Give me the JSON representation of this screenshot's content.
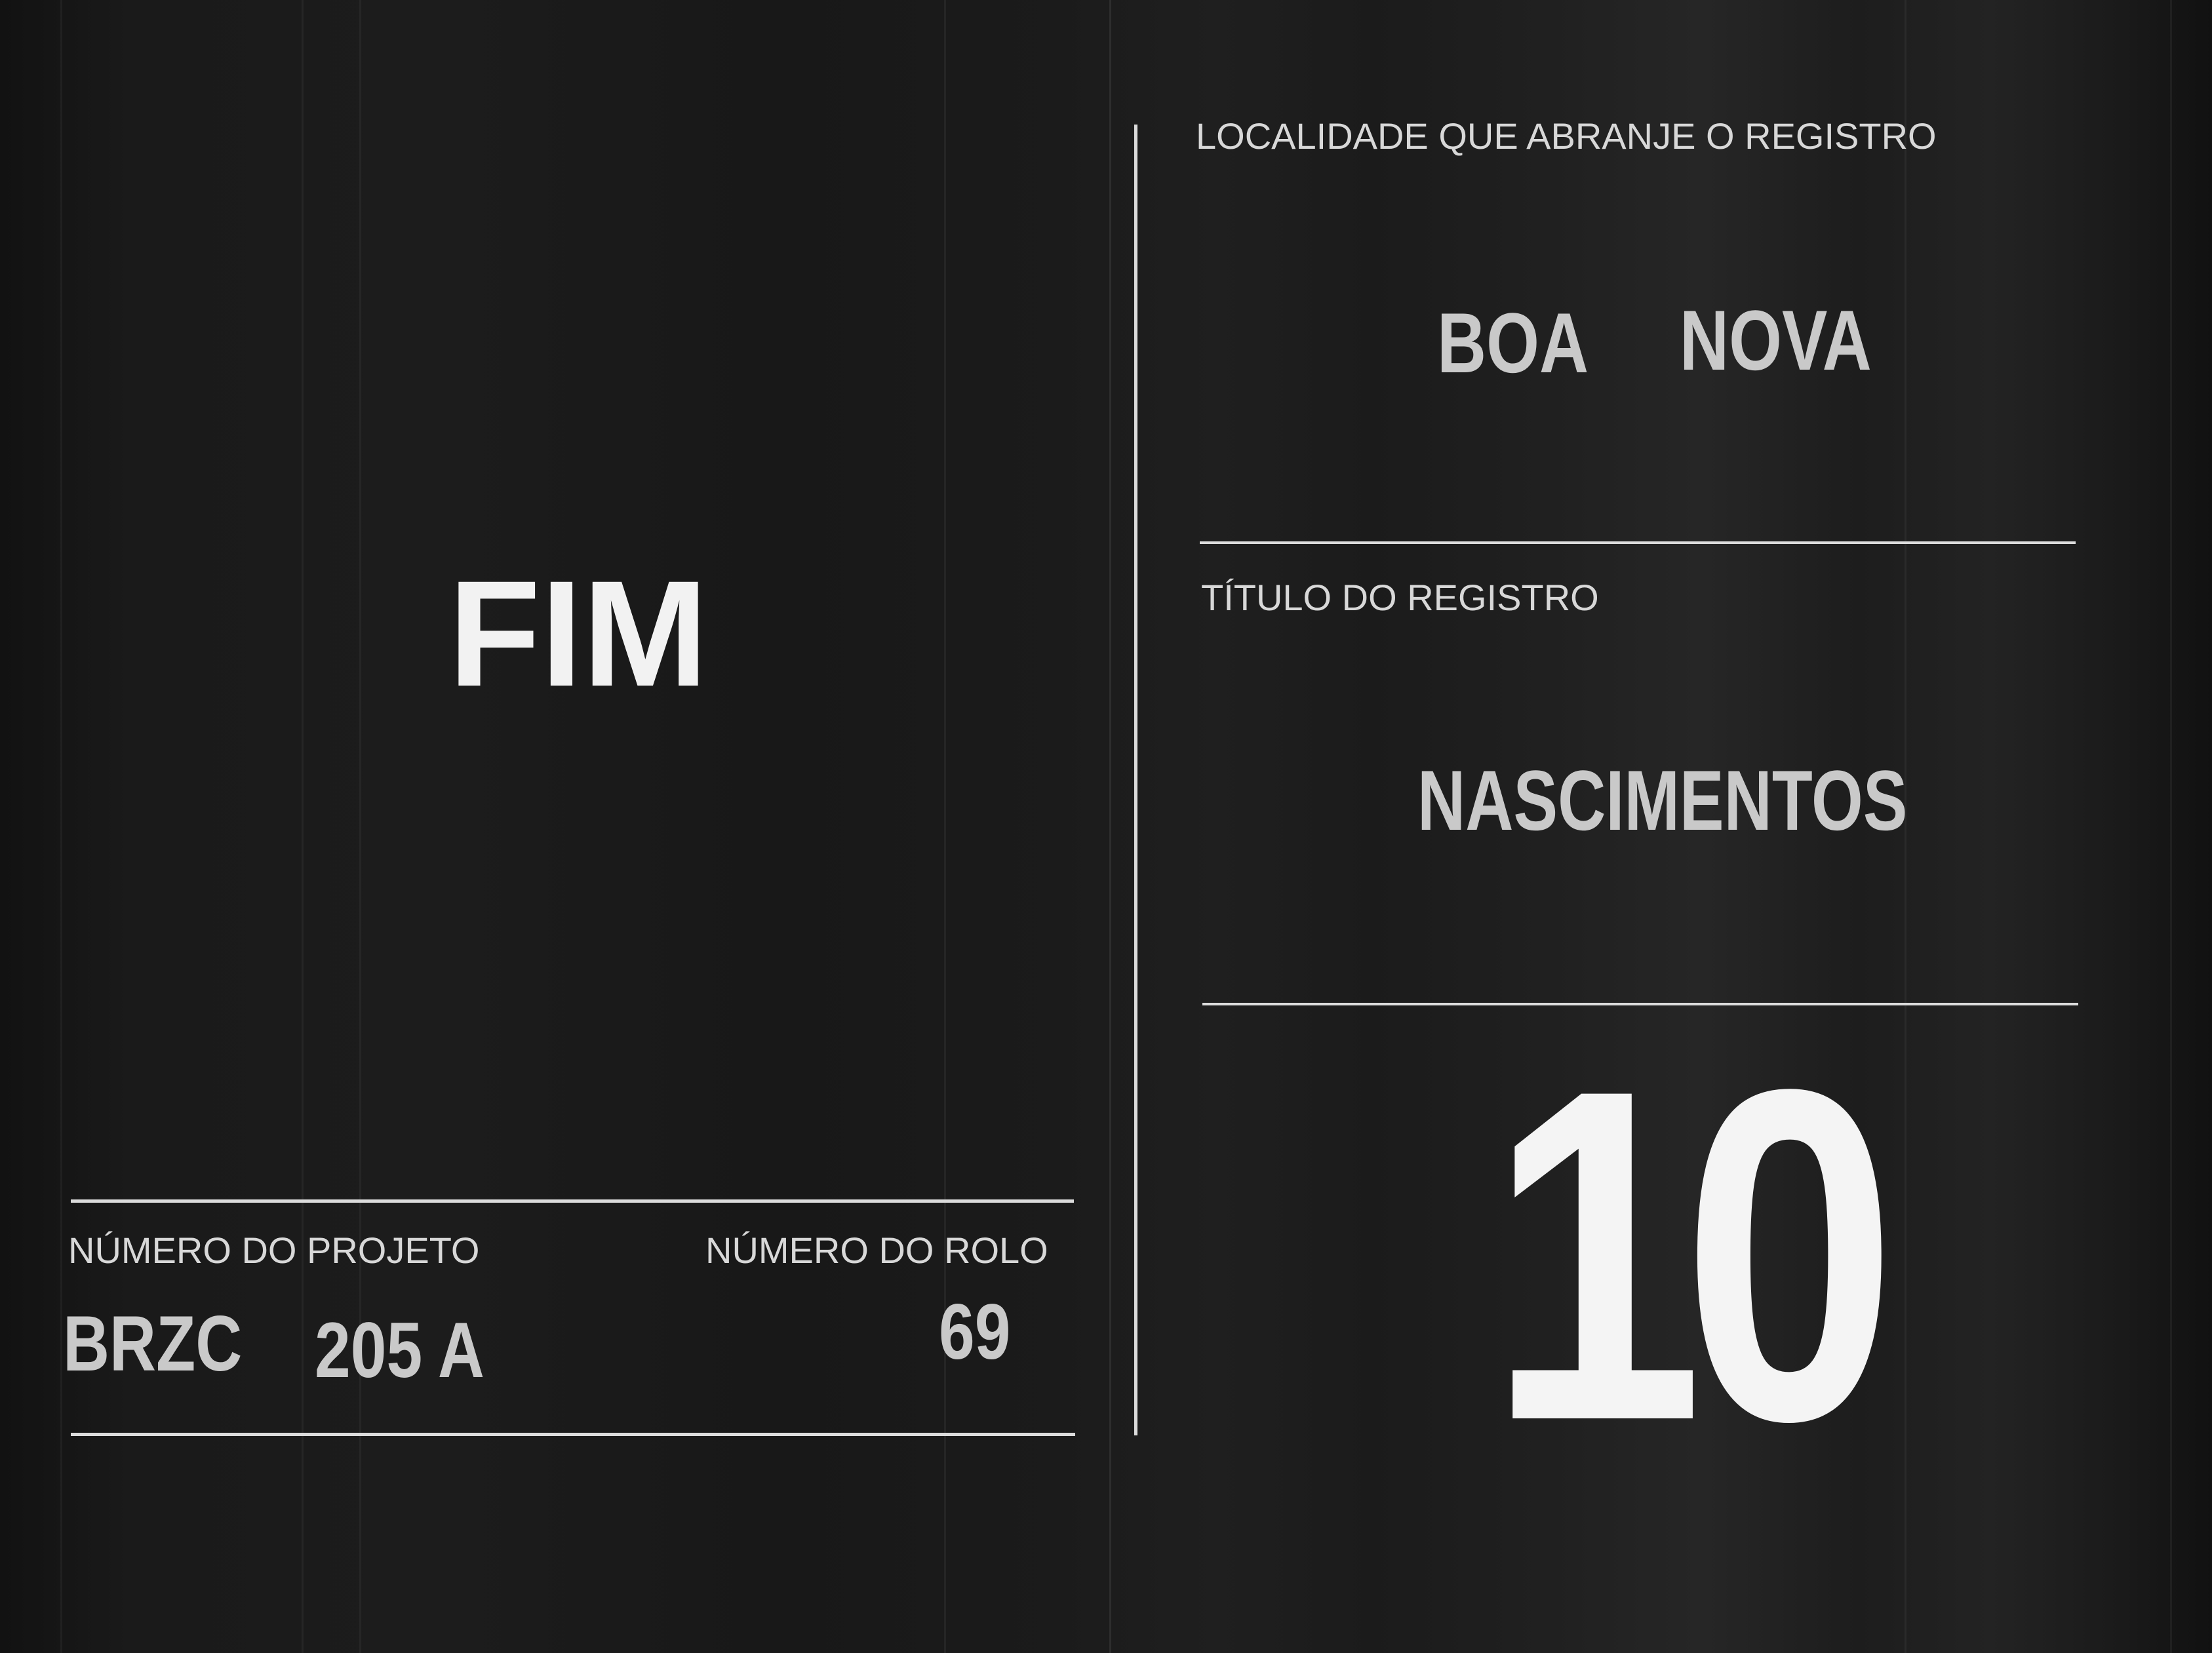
{
  "left_panel": {
    "end_marker": "FIM",
    "project_label": "NÚMERO DO PROJETO",
    "project_value_1": "BRZC",
    "project_value_2": "205 A",
    "roll_label": "NÚMERO DO ROLO",
    "roll_value": "69"
  },
  "right_panel": {
    "locality_label": "LOCALIDADE QUE ABRANJE O REGISTRO",
    "locality_value_1": "BOA",
    "locality_value_2": "NOVA",
    "title_label": "TÍTULO DO REGISTRO",
    "title_value": "NASCIMENTOS",
    "item_number": "10"
  }
}
